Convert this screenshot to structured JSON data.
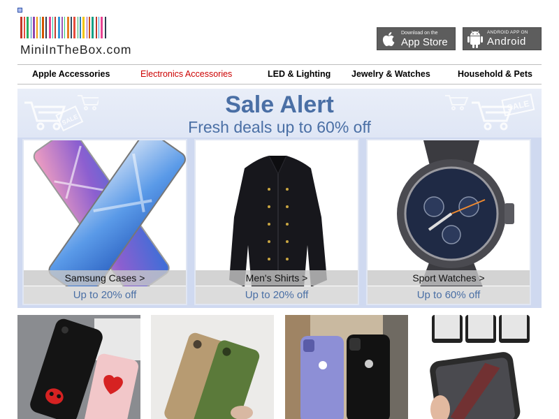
{
  "logo": {
    "text": "MiniInTheBox.com",
    "barcode_colors": [
      "#c0392b",
      "#e74c3c",
      "#27ae60",
      "#2980b9",
      "#8e44ad",
      "#f39c12",
      "#16a085",
      "#d35400",
      "#2c3e50",
      "#e84393",
      "#1abc9c",
      "#c0392b",
      "#3498db",
      "#9b59b6",
      "#2ecc71",
      "#e67e22",
      "#34495e",
      "#e74c3c",
      "#27ae60",
      "#2980b9",
      "#f1c40f",
      "#8e44ad",
      "#d35400",
      "#16a085",
      "#c0392b",
      "#3498db",
      "#e84393",
      "#2c3e50"
    ]
  },
  "app_badges": {
    "apple": {
      "small": "Download on the",
      "big": "App Store",
      "icon": "apple-icon"
    },
    "android": {
      "small": "ANDROID APP ON",
      "big": "Android",
      "icon": "android-icon"
    }
  },
  "nav": {
    "items": [
      {
        "label": "Apple Accessories"
      },
      {
        "label": "Electronics Accessories",
        "active": true
      },
      {
        "label": "LED & Lighting"
      },
      {
        "label": "Jewelry & Watches"
      },
      {
        "label": "Household & Pets"
      }
    ]
  },
  "sale": {
    "title": "Sale Alert",
    "subtitle": "Fresh deals up to 60% off",
    "deco_label": "SALE",
    "cards": [
      {
        "label": "Samsung Cases >",
        "promo": "Up to 20% off",
        "image": "samsung-phone-cases"
      },
      {
        "label": "Men's Shirts >",
        "promo": "Up to 20% off",
        "image": "black-mens-shirt"
      },
      {
        "label": "Sport Watches >",
        "promo": "Up to 60% off",
        "image": "sport-watch"
      }
    ]
  },
  "thumbnails": [
    {
      "image": "black-and-pink-heart-phone-cases"
    },
    {
      "image": "fabric-phone-cases"
    },
    {
      "image": "purple-and-black-iphones"
    },
    {
      "image": "privacy-glass-phone-case"
    }
  ],
  "colors": {
    "accent": "#4a6fa5",
    "nav_active": "#cc0000",
    "sale_bg": "#cfd9f0"
  }
}
